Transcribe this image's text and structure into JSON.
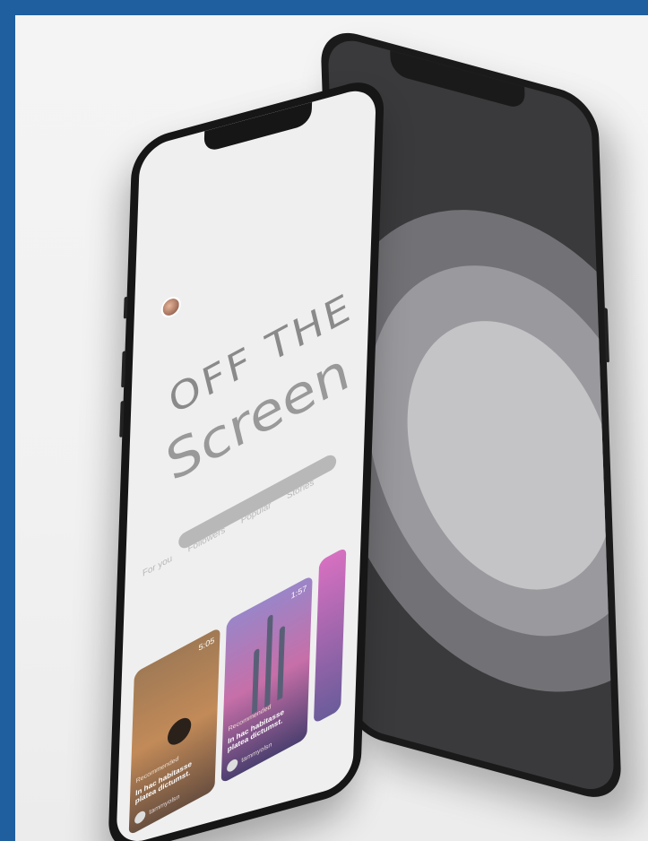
{
  "brand": {
    "logo_top": "OFF THE",
    "logo_bottom": "Screen"
  },
  "tabs": [
    "For you",
    "Followers",
    "Popular",
    "Stories"
  ],
  "cards": [
    {
      "duration": "5:05",
      "tag": "Recommended",
      "title": "In hac habitasse platea dictumst.",
      "user": "tammyolsn"
    },
    {
      "duration": "1:57",
      "tag": "Recommended",
      "title": "In hac habitasse platea dictumst.",
      "user": "tammyolsn"
    }
  ],
  "colors": {
    "page_border": "#1f5f9f",
    "background": "#f2f2f2",
    "phone_body": "#161616"
  }
}
